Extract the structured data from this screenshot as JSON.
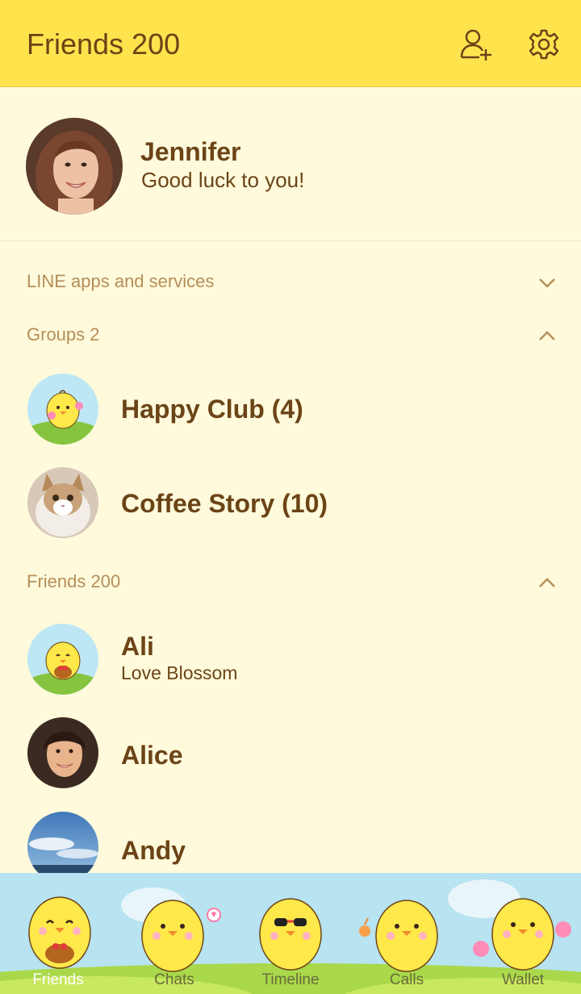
{
  "header": {
    "title": "Friends 200",
    "add_friend_icon": "add-friend-icon",
    "settings_icon": "gear-icon"
  },
  "profile": {
    "name": "Jennifer",
    "status": "Good luck to you!"
  },
  "sections": {
    "services": {
      "label": "LINE apps and services",
      "state": "collapsed"
    },
    "groups": {
      "label": "Groups 2",
      "state": "expanded"
    },
    "friends": {
      "label": "Friends 200",
      "state": "expanded"
    }
  },
  "groups": [
    {
      "name": "Happy Club (4)"
    },
    {
      "name": "Coffee Story (10)"
    }
  ],
  "friends": [
    {
      "name": "Ali",
      "status": "Love Blossom"
    },
    {
      "name": "Alice",
      "status": ""
    },
    {
      "name": "Andy",
      "status": ""
    }
  ],
  "tabs": [
    {
      "label": "Friends",
      "active": true
    },
    {
      "label": "Chats",
      "active": false
    },
    {
      "label": "Timeline",
      "active": false
    },
    {
      "label": "Calls",
      "active": false
    },
    {
      "label": "Wallet",
      "active": false
    }
  ],
  "colors": {
    "header": "#FFE34D",
    "background": "#FFFADC",
    "text": "#6B4417",
    "section_label": "#B58E59"
  }
}
